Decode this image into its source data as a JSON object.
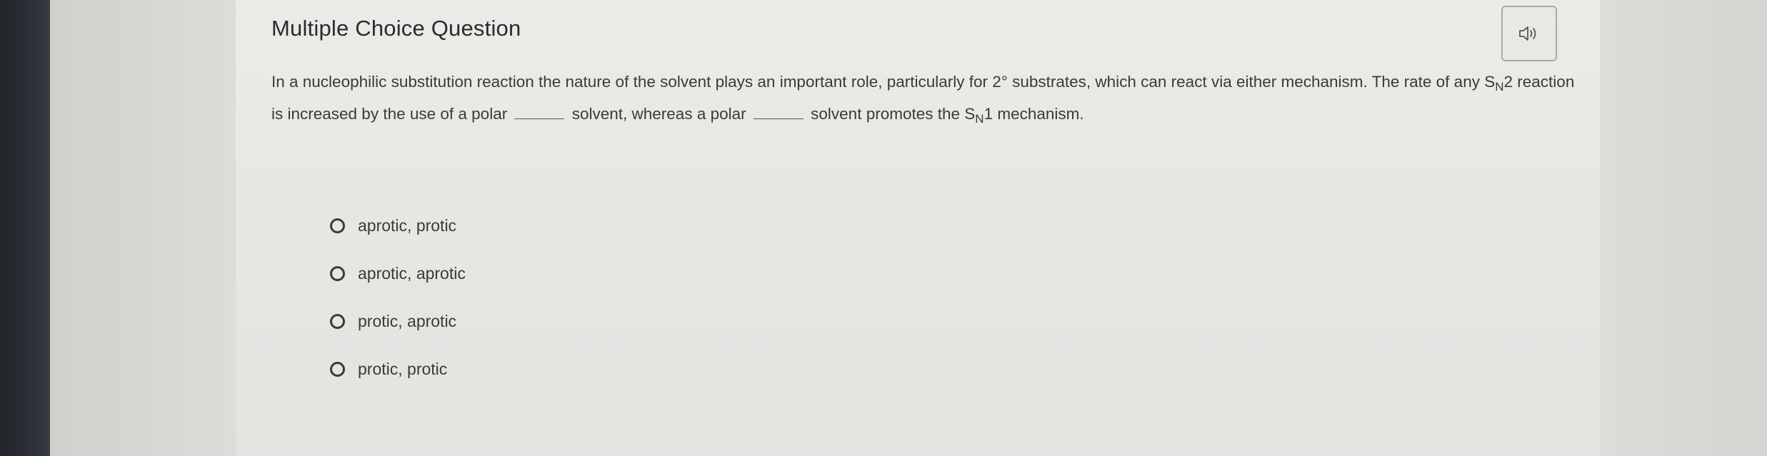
{
  "question": {
    "title": "Multiple Choice Question",
    "text_part1": "In a nucleophilic substitution reaction the nature of the solvent plays an important role, particularly for 2° substrates, which can react via either mechanism. The rate of any S",
    "sub1": "N",
    "text_part2": "2 reaction is increased by the use of a polar",
    "text_part3": "solvent, whereas a polar",
    "text_part4": "solvent promotes the S",
    "sub2": "N",
    "text_part5": "1 mechanism."
  },
  "audio_button": {
    "icon": "speaker-icon"
  },
  "choices": [
    {
      "label": "aprotic, protic",
      "selected": false
    },
    {
      "label": "aprotic, aprotic",
      "selected": false
    },
    {
      "label": "protic, aprotic",
      "selected": false
    },
    {
      "label": "protic, protic",
      "selected": false
    }
  ],
  "colors": {
    "text": "#3a3a3a",
    "card_background": "#ebeae7",
    "dark_edge": "#2a2d33"
  }
}
